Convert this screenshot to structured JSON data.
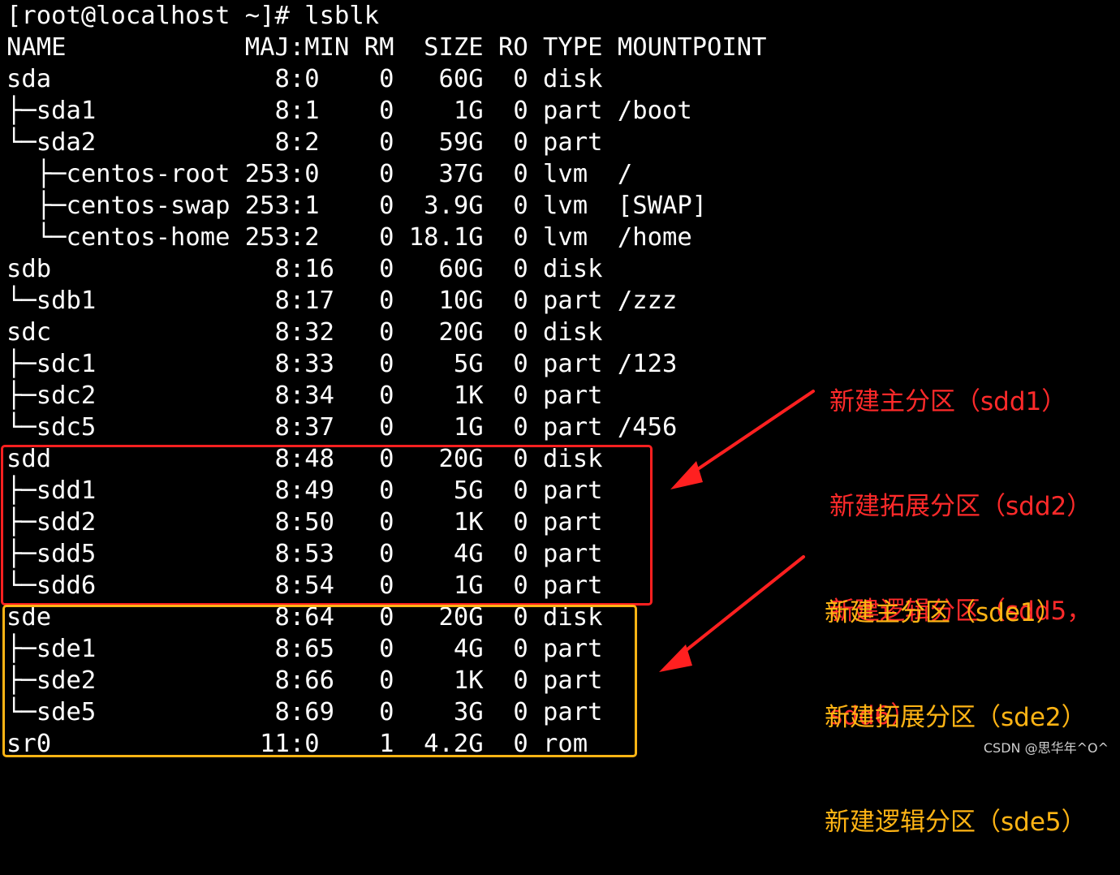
{
  "terminal": {
    "prompt": "[root@localhost ~]# lsblk",
    "header": "NAME            MAJ:MIN RM  SIZE RO TYPE MOUNTPOINT",
    "rows": [
      "sda               8:0    0   60G  0 disk",
      "├─sda1            8:1    0    1G  0 part /boot",
      "└─sda2            8:2    0   59G  0 part",
      "  ├─centos-root 253:0    0   37G  0 lvm  /",
      "  ├─centos-swap 253:1    0  3.9G  0 lvm  [SWAP]",
      "  └─centos-home 253:2    0 18.1G  0 lvm  /home",
      "sdb               8:16   0   60G  0 disk",
      "└─sdb1            8:17   0   10G  0 part /zzz",
      "sdc               8:32   0   20G  0 disk",
      "├─sdc1            8:33   0    5G  0 part /123",
      "├─sdc2            8:34   0    1K  0 part",
      "└─sdc5            8:37   0    1G  0 part /456",
      "sdd               8:48   0   20G  0 disk",
      "├─sdd1            8:49   0    5G  0 part",
      "├─sdd2            8:50   0    1K  0 part",
      "├─sdd5            8:53   0    4G  0 part",
      "└─sdd6            8:54   0    1G  0 part",
      "sde               8:64   0   20G  0 disk",
      "├─sde1            8:65   0    4G  0 part",
      "├─sde2            8:66   0    1K  0 part",
      "└─sde5            8:69   0    3G  0 part",
      "sr0              11:0    1  4.2G  0 rom"
    ]
  },
  "annotations": {
    "sdd": {
      "lines": [
        "新建主分区（sdd1）",
        "新建拓展分区（sdd2）",
        "新建逻辑分区（sdd5，",
        "sdd6）"
      ],
      "color": "#ff2a2a"
    },
    "sde": {
      "lines": [
        "新建主分区（sde1）",
        "新建拓展分区（sde2）",
        "新建逻辑分区（sde5）"
      ],
      "color": "#ffb414"
    }
  },
  "watermark": "CSDN @思华年^O^",
  "colors": {
    "background": "#000000",
    "text": "#ffffff",
    "red_box": "#ff2020",
    "yellow_box": "#ffb414"
  }
}
